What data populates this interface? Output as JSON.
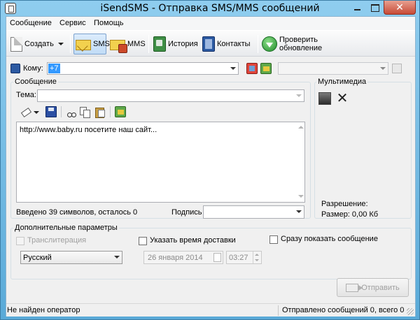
{
  "window": {
    "title": "iSendSMS - Отправка SMS/MMS сообщений",
    "close_glyph": "✕"
  },
  "menu": [
    "Сообщение",
    "Сервис",
    "Помощь"
  ],
  "toolbar": {
    "create": "Создать",
    "sms": "SMS",
    "mms": "MMS",
    "history": "История",
    "contacts": "Контакты",
    "check_update": "Проверить обновление"
  },
  "recipient": {
    "label": "Кому:",
    "value": "+7",
    "operator": ""
  },
  "message": {
    "group_title": "Сообщение",
    "subject_label": "Тема:",
    "subject_value": "",
    "text": "http://www.baby.ru посетите наш сайт...",
    "counter": "Введено 39 символов, осталось 0",
    "signature_label": "Подпись",
    "signature_value": ""
  },
  "multimedia": {
    "group_title": "Мультимедиа",
    "delete_glyph": "✕",
    "resolution_label": "Разрешение:",
    "size_label": "Размер: 0,00 Кб"
  },
  "options": {
    "group_title": "Дополнительные параметры",
    "transliteration": "Транслитерация",
    "transliteration_checked": false,
    "delivery_time": "Указать время доставки",
    "delivery_time_checked": false,
    "show_immediately": "Сразу показать сообщение",
    "show_immediately_checked": false,
    "language": "Русский",
    "date": "26   января   2014",
    "time": "03:27"
  },
  "send_button": "Отправить",
  "status": {
    "left": "Не найден оператор",
    "right": "Отправлено сообщений 0, всего 0"
  },
  "colors": {
    "selection": "#3399ff",
    "disabled_text": "#a0a0a0"
  }
}
